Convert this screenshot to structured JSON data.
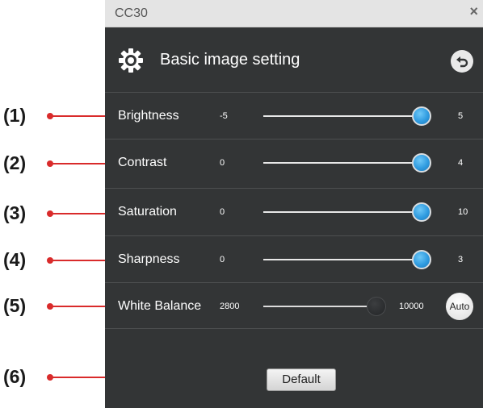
{
  "window": {
    "title": "CC30",
    "close_glyph": "×"
  },
  "header": {
    "title": "Basic image setting",
    "settings_icon": "gear-icon",
    "back_icon": "back-arrow-icon"
  },
  "settings": [
    {
      "label": "Brightness",
      "min": "-5",
      "max": "5",
      "value": 5,
      "active": true
    },
    {
      "label": "Contrast",
      "min": "0",
      "max": "4",
      "value": 4,
      "active": true
    },
    {
      "label": "Saturation",
      "min": "0",
      "max": "10",
      "value": 10,
      "active": true
    },
    {
      "label": "Sharpness",
      "min": "0",
      "max": "3",
      "value": 3,
      "active": true
    },
    {
      "label": "White Balance",
      "min": "2800",
      "max": "10000",
      "value": 10000,
      "active": false,
      "auto_label": "Auto"
    }
  ],
  "footer": {
    "default_label": "Default"
  },
  "callouts": [
    "(1)",
    "(2)",
    "(3)",
    "(4)",
    "(5)",
    "(6)"
  ],
  "colors": {
    "panel_bg": "#333536",
    "accent": "#2f9be0",
    "callout_red": "#d92b2b"
  }
}
